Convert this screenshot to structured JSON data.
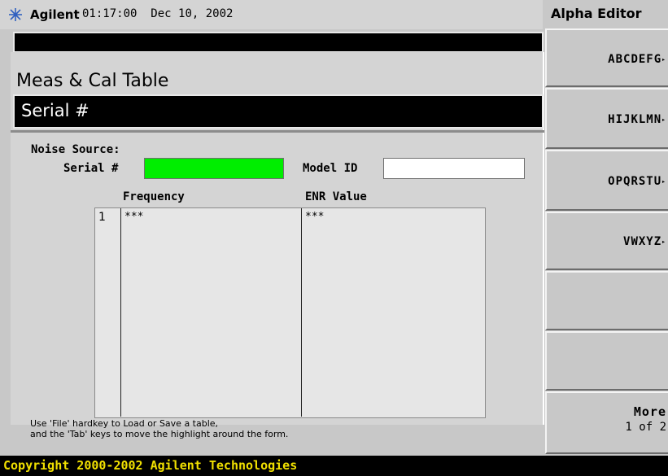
{
  "status_bar": {
    "brand": "Agilent",
    "time": "01:17:00",
    "date": "Dec 10, 2002"
  },
  "screen": {
    "title": "Meas & Cal Table",
    "active_function": "Serial #"
  },
  "form": {
    "noise_source_label": "Noise Source:",
    "serial_label": "Serial #",
    "serial_value": "",
    "model_id_label": "Model ID",
    "model_id_value": ""
  },
  "table": {
    "columns": [
      "Frequency",
      "ENR Value"
    ],
    "rows": [
      {
        "index": "1",
        "frequency": "***",
        "enr": "***"
      }
    ]
  },
  "help_text": [
    "Use 'File' hardkey to Load or Save a table,",
    "and the 'Tab' keys to move the highlight around the form."
  ],
  "copyright": "Copyright 2000-2002 Agilent Technologies",
  "softkeys": {
    "menu_title": "Alpha Editor",
    "keys": [
      {
        "label": "ABCDEFG",
        "arrow": "▸"
      },
      {
        "label": "HIJKLMN",
        "arrow": "▸"
      },
      {
        "label": "OPQRSTU",
        "arrow": "▸"
      },
      {
        "label": "VWXYZ",
        "arrow": "▸"
      },
      {
        "label": ""
      },
      {
        "label": ""
      },
      {
        "label": "More",
        "sub": "1 of 2"
      }
    ]
  },
  "colors": {
    "active_field": "#00ee00",
    "copyright_text": "#f0e000",
    "background": "#c8c8c8"
  }
}
